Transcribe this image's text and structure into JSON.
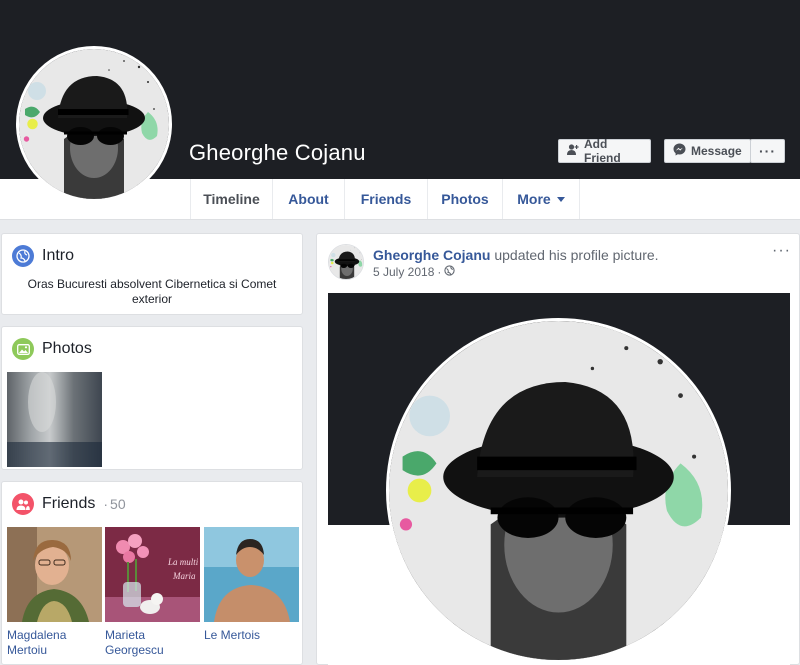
{
  "profile": {
    "name": "Gheorghe Cojanu"
  },
  "actions": {
    "add_friend": "Add Friend",
    "message": "Message",
    "more": "···"
  },
  "tabs": [
    {
      "label": "Timeline"
    },
    {
      "label": "About"
    },
    {
      "label": "Friends"
    },
    {
      "label": "Photos"
    },
    {
      "label": "More"
    }
  ],
  "intro": {
    "title": "Intro",
    "bio": "Oras Bucuresti absolvent Cibernetica si Comet exterior"
  },
  "photos": {
    "title": "Photos"
  },
  "friends": {
    "title": "Friends",
    "separator": "·",
    "count": "50",
    "items": [
      {
        "name": "Magdalena Mertoiu"
      },
      {
        "name": "Marieta Georgescu"
      },
      {
        "name": "Le Mertois"
      }
    ]
  },
  "post": {
    "author": "Gheorghe Cojanu",
    "action": " updated his profile picture.",
    "date": "5 July 2018",
    "date_sep": "·",
    "menu": "···"
  },
  "colors": {
    "brand_link": "#365899",
    "cover_dark": "#1d1f24",
    "page_bg": "#e9ebee"
  }
}
